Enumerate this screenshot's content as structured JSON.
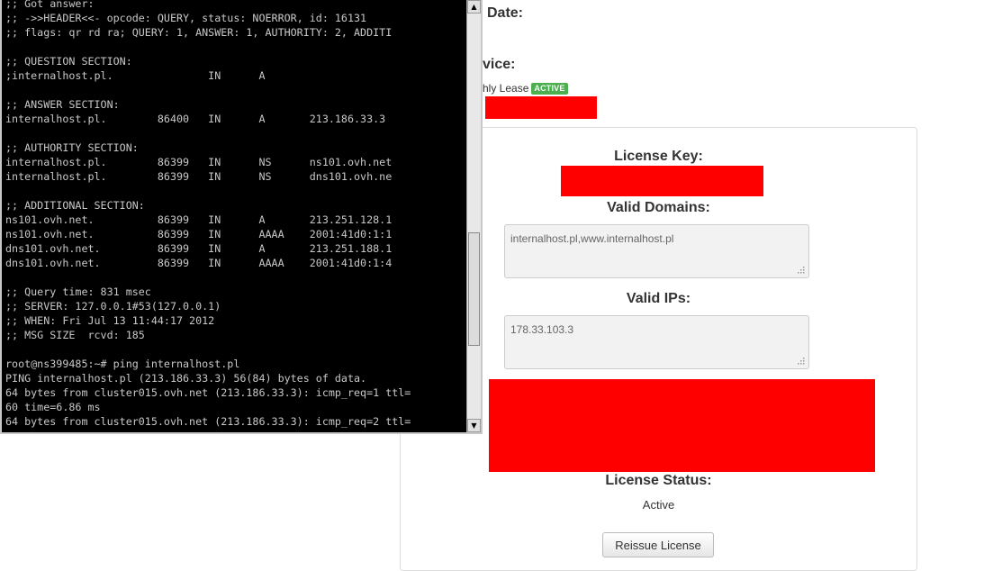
{
  "page": {
    "next_due_date_label": "Date:",
    "service_label": "vice:",
    "lease_text": "hly Lease",
    "lease_badge": "ACTIVE",
    "badge_color": "#4caf50",
    "redaction_color": "#ff0000"
  },
  "license": {
    "key_label": "License Key:",
    "domains_label": "Valid Domains:",
    "domains_value": "internalhost.pl,www.internalhost.pl",
    "ips_label": "Valid IPs:",
    "ips_value": "178.33.103.3",
    "status_label": "License Status:",
    "status_value": "Active",
    "reissue_button": "Reissue License"
  },
  "terminal": {
    "background": "#000000",
    "text_color": "#c8c8c8",
    "lines": [
      ";; Got answer:",
      ";; ->>HEADER<<- opcode: QUERY, status: NOERROR, id: 16131",
      ";; flags: qr rd ra; QUERY: 1, ANSWER: 1, AUTHORITY: 2, ADDITI",
      "",
      ";; QUESTION SECTION:",
      ";internalhost.pl.               IN      A",
      "",
      ";; ANSWER SECTION:",
      "internalhost.pl.        86400   IN      A       213.186.33.3",
      "",
      ";; AUTHORITY SECTION:",
      "internalhost.pl.        86399   IN      NS      ns101.ovh.net",
      "internalhost.pl.        86399   IN      NS      dns101.ovh.ne",
      "",
      ";; ADDITIONAL SECTION:",
      "ns101.ovh.net.          86399   IN      A       213.251.128.1",
      "ns101.ovh.net.          86399   IN      AAAA    2001:41d0:1:1",
      "dns101.ovh.net.         86399   IN      A       213.251.188.1",
      "dns101.ovh.net.         86399   IN      AAAA    2001:41d0:1:4",
      "",
      ";; Query time: 831 msec",
      ";; SERVER: 127.0.0.1#53(127.0.0.1)",
      ";; WHEN: Fri Jul 13 11:44:17 2012",
      ";; MSG SIZE  rcvd: 185",
      "",
      "root@ns399485:~# ping internalhost.pl",
      "PING internalhost.pl (213.186.33.3) 56(84) bytes of data.",
      "64 bytes from cluster015.ovh.net (213.186.33.3): icmp_req=1 ttl=",
      "60 time=6.86 ms",
      "64 bytes from cluster015.ovh.net (213.186.33.3): icmp_req=2 ttl="
    ],
    "scroll_up_icon": "triangle-up-icon",
    "scroll_down_icon": "triangle-down-icon"
  }
}
